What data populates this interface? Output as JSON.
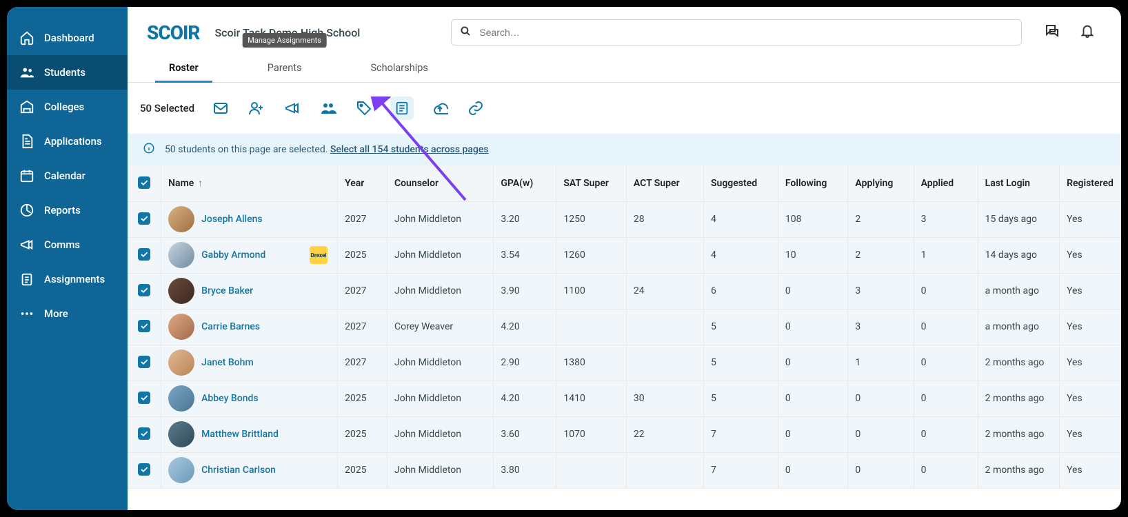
{
  "sidebar": {
    "items": [
      {
        "label": "Dashboard"
      },
      {
        "label": "Students"
      },
      {
        "label": "Colleges"
      },
      {
        "label": "Applications"
      },
      {
        "label": "Calendar"
      },
      {
        "label": "Reports"
      },
      {
        "label": "Comms"
      },
      {
        "label": "Assignments"
      },
      {
        "label": "More"
      }
    ]
  },
  "header": {
    "logo": "SCOIR",
    "school": "Scoir Task Demo High School",
    "search_placeholder": "Search…"
  },
  "tabs": {
    "roster": "Roster",
    "parents": "Parents",
    "scholarships": "Scholarships"
  },
  "tooltip": {
    "manage_assignments": "Manage Assignments"
  },
  "actionbar": {
    "selected": "50 Selected"
  },
  "banner": {
    "prefix": "50 students on this page are selected. ",
    "link": "Select all 154 students across pages"
  },
  "columns": {
    "name": "Name",
    "year": "Year",
    "counselor": "Counselor",
    "gpa": "GPA(w)",
    "sat": "SAT Super",
    "act": "ACT Super",
    "suggested": "Suggested",
    "following": "Following",
    "applying": "Applying",
    "applied": "Applied",
    "last_login": "Last Login",
    "registered": "Registered"
  },
  "rows": [
    {
      "name": "Joseph Allens",
      "year": "2027",
      "counselor": "John Middleton",
      "gpa": "3.20",
      "sat": "1250",
      "act": "28",
      "suggested": "4",
      "following": "108",
      "applying": "2",
      "applied": "3",
      "login": "15 days ago",
      "reg": "Yes"
    },
    {
      "name": "Gabby Armond",
      "year": "2025",
      "counselor": "John Middleton",
      "gpa": "3.54",
      "sat": "1260",
      "act": "",
      "suggested": "4",
      "following": "10",
      "applying": "2",
      "applied": "1",
      "login": "14 days ago",
      "reg": "Yes",
      "drexel": true
    },
    {
      "name": "Bryce Baker",
      "year": "2027",
      "counselor": "John Middleton",
      "gpa": "3.90",
      "sat": "1100",
      "act": "24",
      "suggested": "6",
      "following": "0",
      "applying": "3",
      "applied": "0",
      "login": "a month ago",
      "reg": "Yes"
    },
    {
      "name": "Carrie Barnes",
      "year": "2027",
      "counselor": "Corey Weaver",
      "gpa": "4.20",
      "sat": "",
      "act": "",
      "suggested": "5",
      "following": "0",
      "applying": "3",
      "applied": "0",
      "login": "a month ago",
      "reg": "Yes"
    },
    {
      "name": "Janet Bohm",
      "year": "2027",
      "counselor": "John Middleton",
      "gpa": "2.90",
      "sat": "1380",
      "act": "",
      "suggested": "5",
      "following": "0",
      "applying": "1",
      "applied": "0",
      "login": "2 months ago",
      "reg": "Yes"
    },
    {
      "name": "Abbey Bonds",
      "year": "2025",
      "counselor": "John Middleton",
      "gpa": "4.20",
      "sat": "1410",
      "act": "30",
      "suggested": "5",
      "following": "0",
      "applying": "0",
      "applied": "0",
      "login": "2 months ago",
      "reg": "Yes"
    },
    {
      "name": "Matthew Brittland",
      "year": "2025",
      "counselor": "John Middleton",
      "gpa": "3.60",
      "sat": "1070",
      "act": "22",
      "suggested": "7",
      "following": "0",
      "applying": "0",
      "applied": "0",
      "login": "2 months ago",
      "reg": "Yes"
    },
    {
      "name": "Christian Carlson",
      "year": "2025",
      "counselor": "John Middleton",
      "gpa": "3.80",
      "sat": "",
      "act": "",
      "suggested": "7",
      "following": "0",
      "applying": "0",
      "applied": "0",
      "login": "2 months ago",
      "reg": "Yes"
    }
  ]
}
